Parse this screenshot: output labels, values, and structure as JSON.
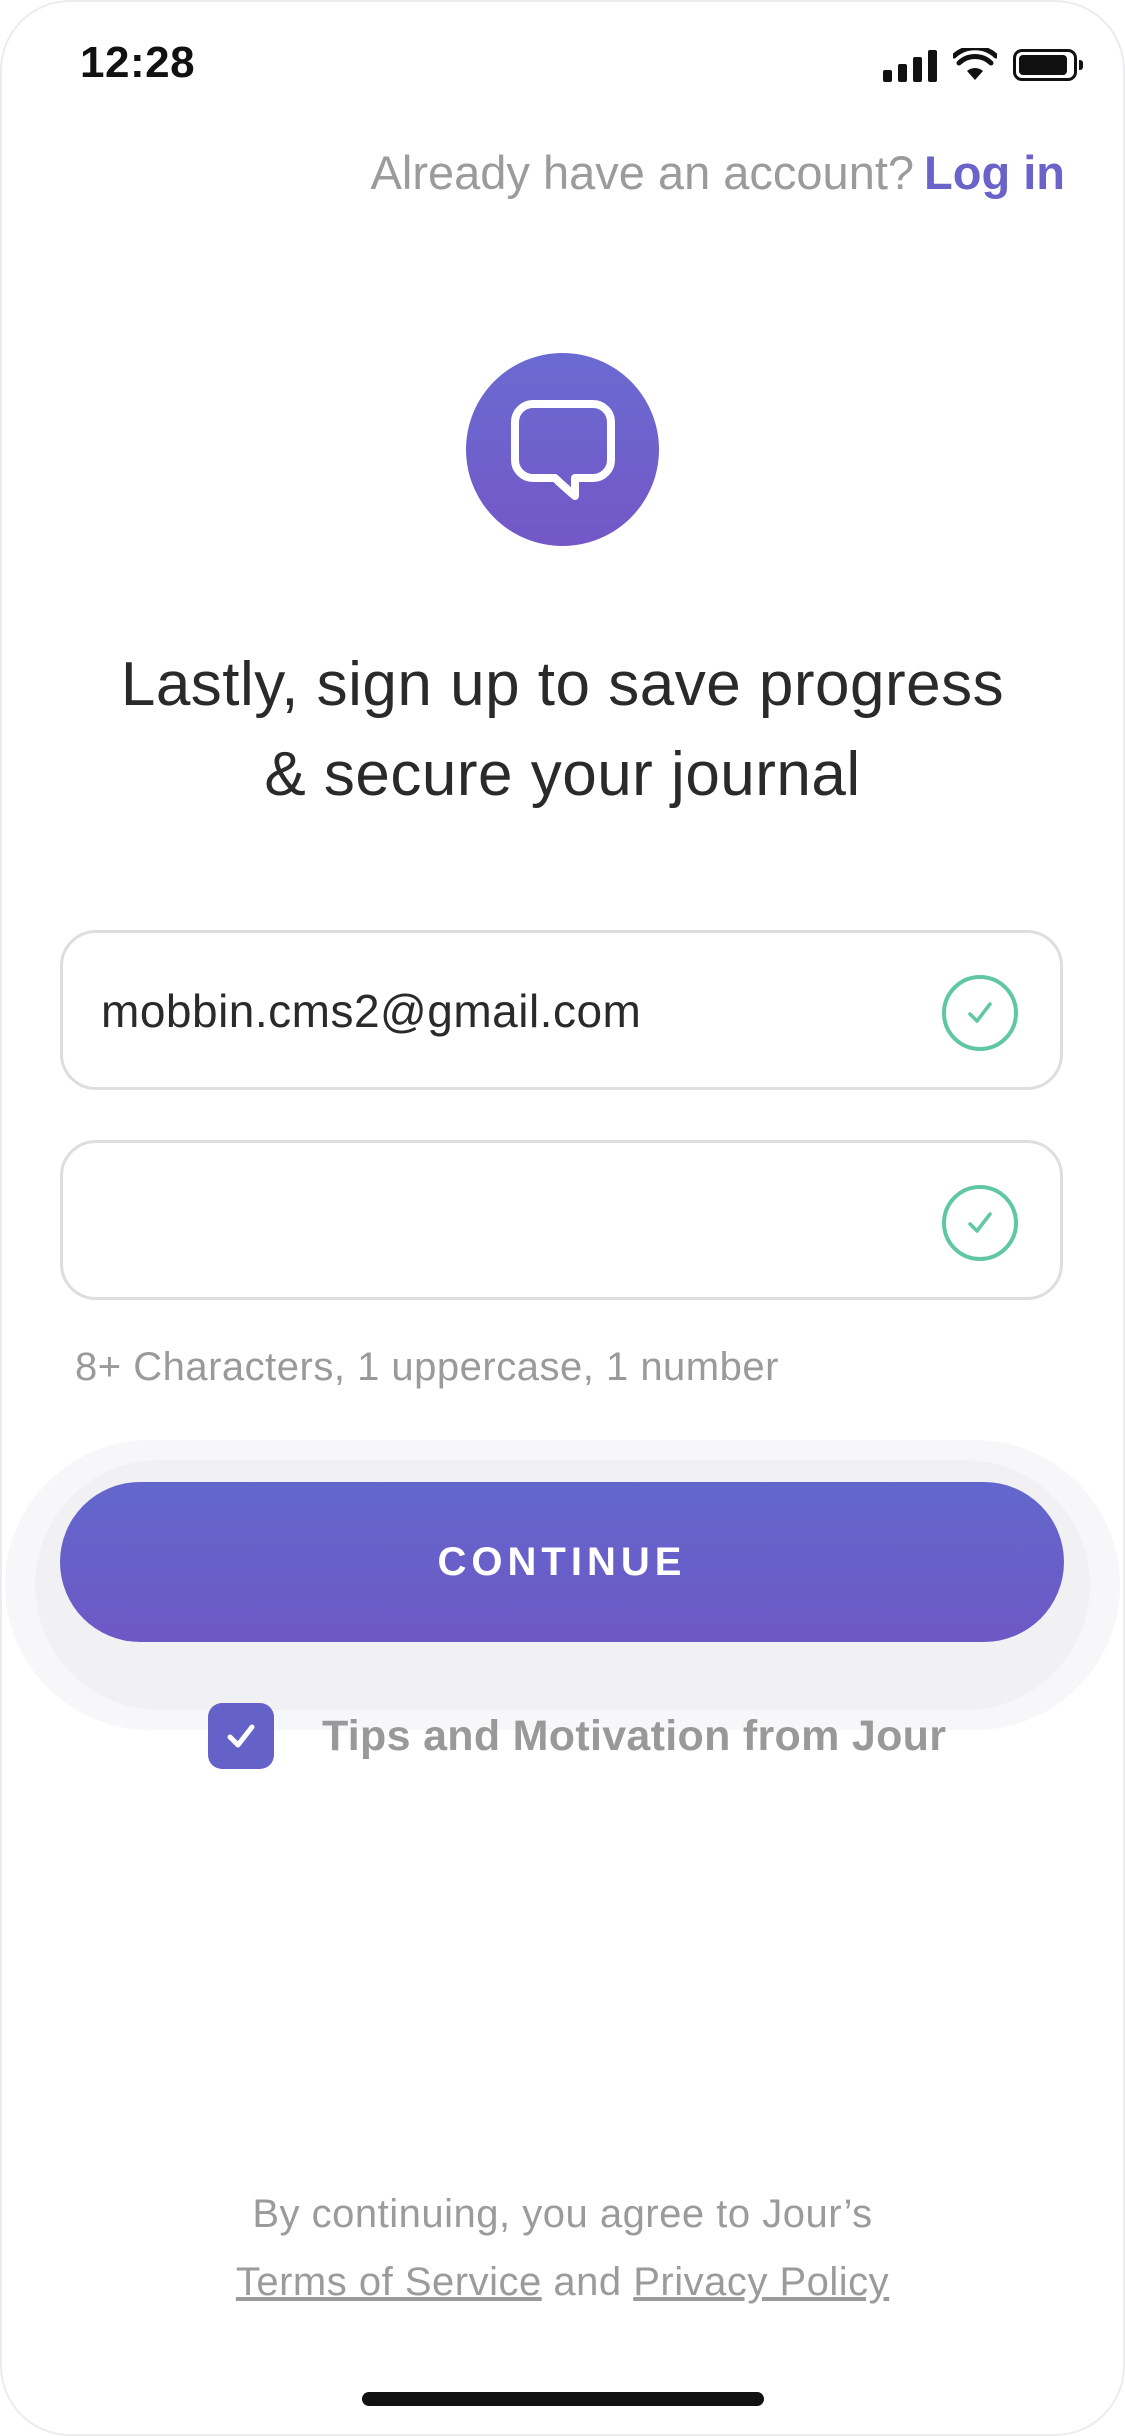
{
  "status_bar": {
    "time": "12:28",
    "icons": [
      "signal-icon",
      "wifi-icon",
      "battery-icon"
    ]
  },
  "header": {
    "already_text": "Already have an account?",
    "login_label": "Log in"
  },
  "logo": {
    "icon": "speech-bubble-icon"
  },
  "heading": {
    "line1": "Lastly, sign up to save progress",
    "line2": "& secure your journal"
  },
  "form": {
    "email_value": "mobbin.cms2@gmail.com",
    "password_value": "",
    "password_hint": "8+ Characters, 1 uppercase, 1 number"
  },
  "continue_label": "CONTINUE",
  "newsletter": {
    "checked": true,
    "label": "Tips and Motivation from Jour"
  },
  "legal": {
    "line1": "By continuing, you agree to Jour’s",
    "terms": "Terms of Service",
    "and": "and",
    "privacy": "Privacy Policy"
  },
  "colors": {
    "accent": "#6a63c9",
    "valid": "#5fc7a1",
    "muted_text": "#9b9b9b"
  }
}
